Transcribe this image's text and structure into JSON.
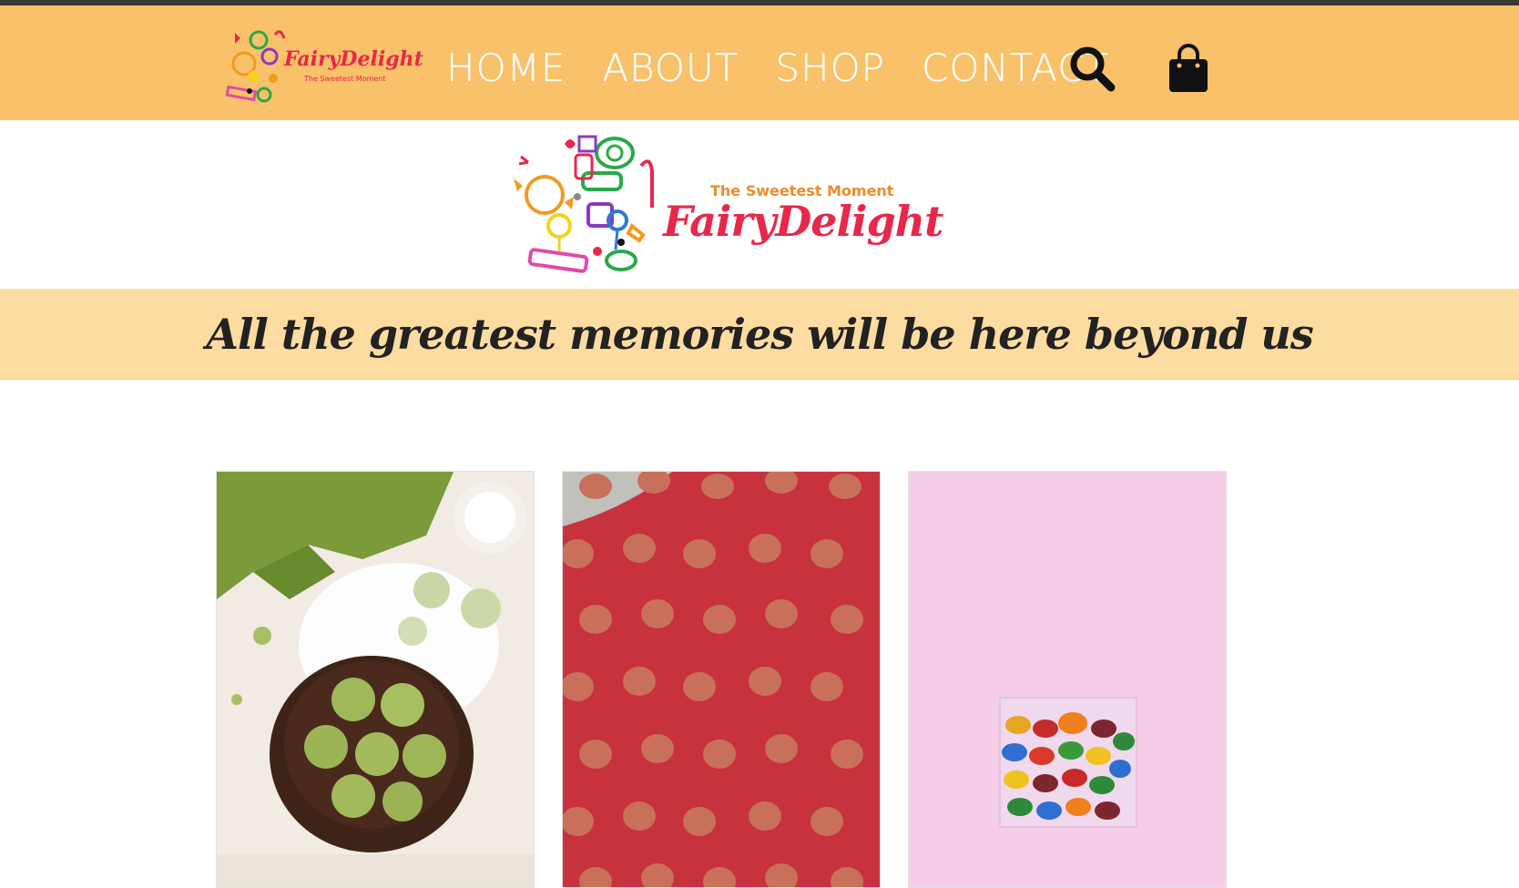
{
  "brand": {
    "name": "FairyDelight",
    "tagline": "The Sweetest Moment"
  },
  "nav": {
    "items": [
      {
        "label": "HOME"
      },
      {
        "label": "ABOUT"
      },
      {
        "label": "SHOP"
      },
      {
        "label": "CONTACT"
      }
    ]
  },
  "banner": {
    "text": "All the greatest memories will be here beyond us"
  },
  "products": [
    {
      "image": "matcha-truffles"
    },
    {
      "image": "raspberry-dusted-truffles"
    },
    {
      "image": "candy-box"
    }
  ],
  "colors": {
    "nav_bg": "#f8c16a",
    "banner_bg": "#fddca1",
    "brand_red": "#e8274a",
    "top_bar": "#3a3a3a"
  }
}
